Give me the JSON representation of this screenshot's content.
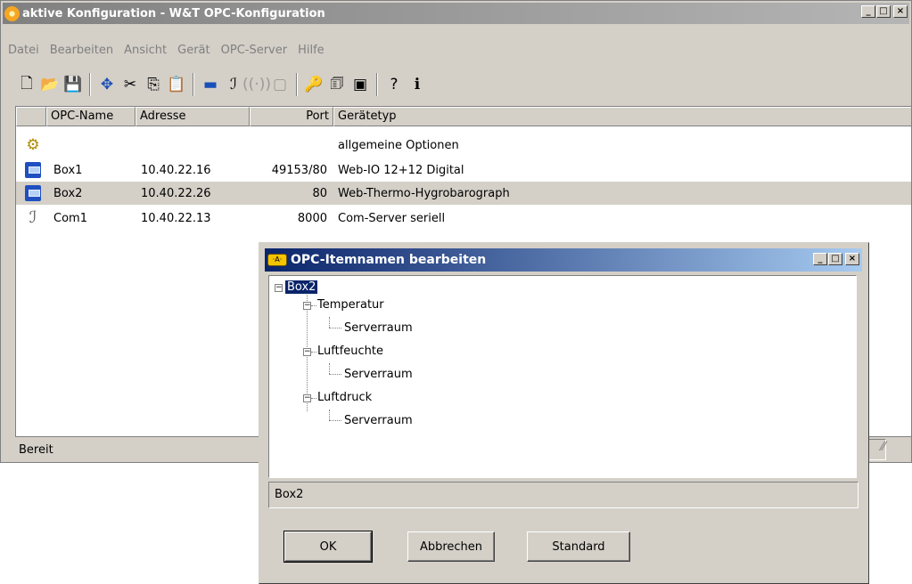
{
  "main_window": {
    "title": "aktive Konfiguration - W&T OPC-Konfiguration",
    "title_buttons": {
      "minimize": "_",
      "maximize": "□",
      "close": "×"
    },
    "menu": [
      "Datei",
      "Bearbeiten",
      "Ansicht",
      "Gerät",
      "OPC-Server",
      "Hilfe"
    ],
    "toolbar": {
      "new": "🗋",
      "open": "📂",
      "save": "💾",
      "move": "✥",
      "cut": "✂",
      "copy": "⎘",
      "paste": "📋",
      "device": "▬",
      "com": "ℐ",
      "wireless": "((·))",
      "disabled_item": "▢",
      "key": "🔑",
      "properties": "🗊",
      "itemnames": "▣",
      "help": "?",
      "info": "ℹ"
    },
    "list": {
      "headers": [
        "",
        "OPC-Name",
        "Adresse",
        "Port",
        "Gerätetyp"
      ],
      "rows": [
        {
          "icon": "gear-icon",
          "name": "",
          "address": "",
          "port": "",
          "type": "allgemeine Optionen"
        },
        {
          "icon": "box-device-icon",
          "name": "Box1",
          "address": "10.40.22.16",
          "port": "49153/80",
          "type": "Web-IO 12+12 Digital"
        },
        {
          "icon": "box-device-icon",
          "name": "Box2",
          "address": "10.40.22.26",
          "port": "80",
          "type": "Web-Thermo-Hygrobarograph"
        },
        {
          "icon": "com-server-icon",
          "name": "Com1",
          "address": "10.40.22.13",
          "port": "8000",
          "type": "Com-Server seriell"
        }
      ],
      "selected_row": 2
    },
    "status": "Bereit"
  },
  "dialog": {
    "title": "OPC-Itemnamen bearbeiten",
    "tree": {
      "root": "Box2",
      "groups": [
        {
          "label": "Temperatur",
          "child": "Serverraum"
        },
        {
          "label": "Luftfeuchte",
          "child": "Serverraum"
        },
        {
          "label": "Luftdruck",
          "child": "Serverraum"
        }
      ]
    },
    "selected_path": "Box2",
    "buttons": {
      "ok": "OK",
      "cancel": "Abbrechen",
      "default": "Standard"
    }
  },
  "colors": {
    "titlebar_inactive": "#808080",
    "titlebar_active": "#0a246a",
    "face": "#d4d0c8",
    "selection": "#0a246a"
  }
}
